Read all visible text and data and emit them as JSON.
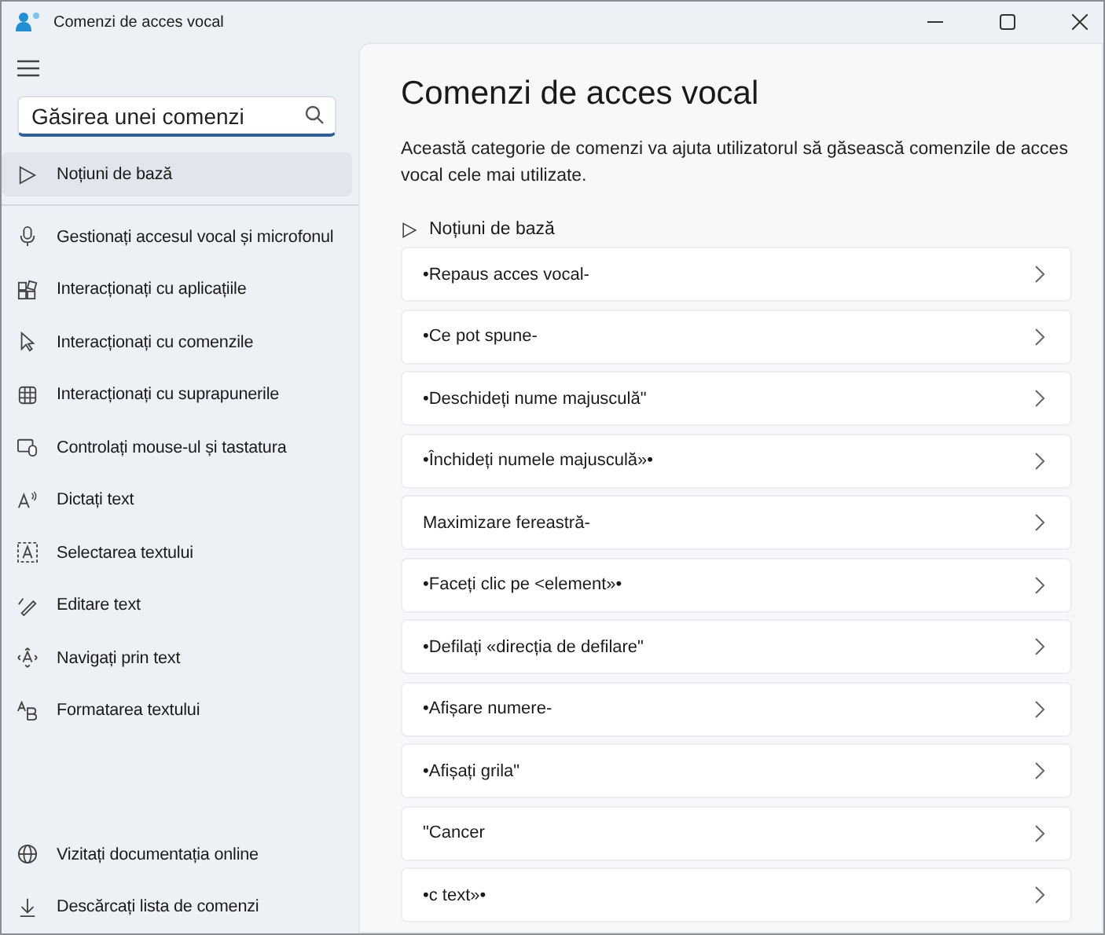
{
  "window": {
    "title": "Comenzi de acces vocal"
  },
  "search": {
    "placeholder": "Găsirea unei comenzi"
  },
  "nav_items": [
    {
      "label": "Noțiuni de bază",
      "selected": true
    },
    {
      "label": "Gestionați accesul vocal și microfonul",
      "selected": false
    },
    {
      "label": "Interacționați cu aplicațiile",
      "selected": false
    },
    {
      "label": "Interacționați cu comenzile",
      "selected": false
    },
    {
      "label": "Interacționați cu suprapunerile",
      "selected": false
    },
    {
      "label": "Controlați mouse-ul și tastatura",
      "selected": false
    },
    {
      "label": "Dictați text",
      "selected": false
    },
    {
      "label": "Selectarea textului",
      "selected": false
    },
    {
      "label": "Editare text",
      "selected": false
    },
    {
      "label": "Navigați prin text",
      "selected": false
    },
    {
      "label": "Formatarea textului",
      "selected": false
    }
  ],
  "footer_items": [
    {
      "label": "Vizitați documentația online"
    },
    {
      "label": "Descărcați lista de comenzi"
    }
  ],
  "main": {
    "heading": "Comenzi de acces vocal",
    "description": "Această categorie de comenzi va ajuta utilizatorul să găsească comenzile de acces vocal cele mai utilizate.",
    "section": "Noțiuni de bază",
    "commands": [
      "•Repaus acces vocal-",
      "•Ce pot spune-",
      "•Deschideți nume majusculă\"",
      "•Închideți numele majusculă»•",
      "Maximizare fereastră-",
      "•Faceți clic pe <element»•",
      "•Defilați «direcția de defilare\"",
      "•Afișare numere-",
      "•Afișați grila\"",
      "\"Cancer",
      "•c text»•"
    ]
  }
}
